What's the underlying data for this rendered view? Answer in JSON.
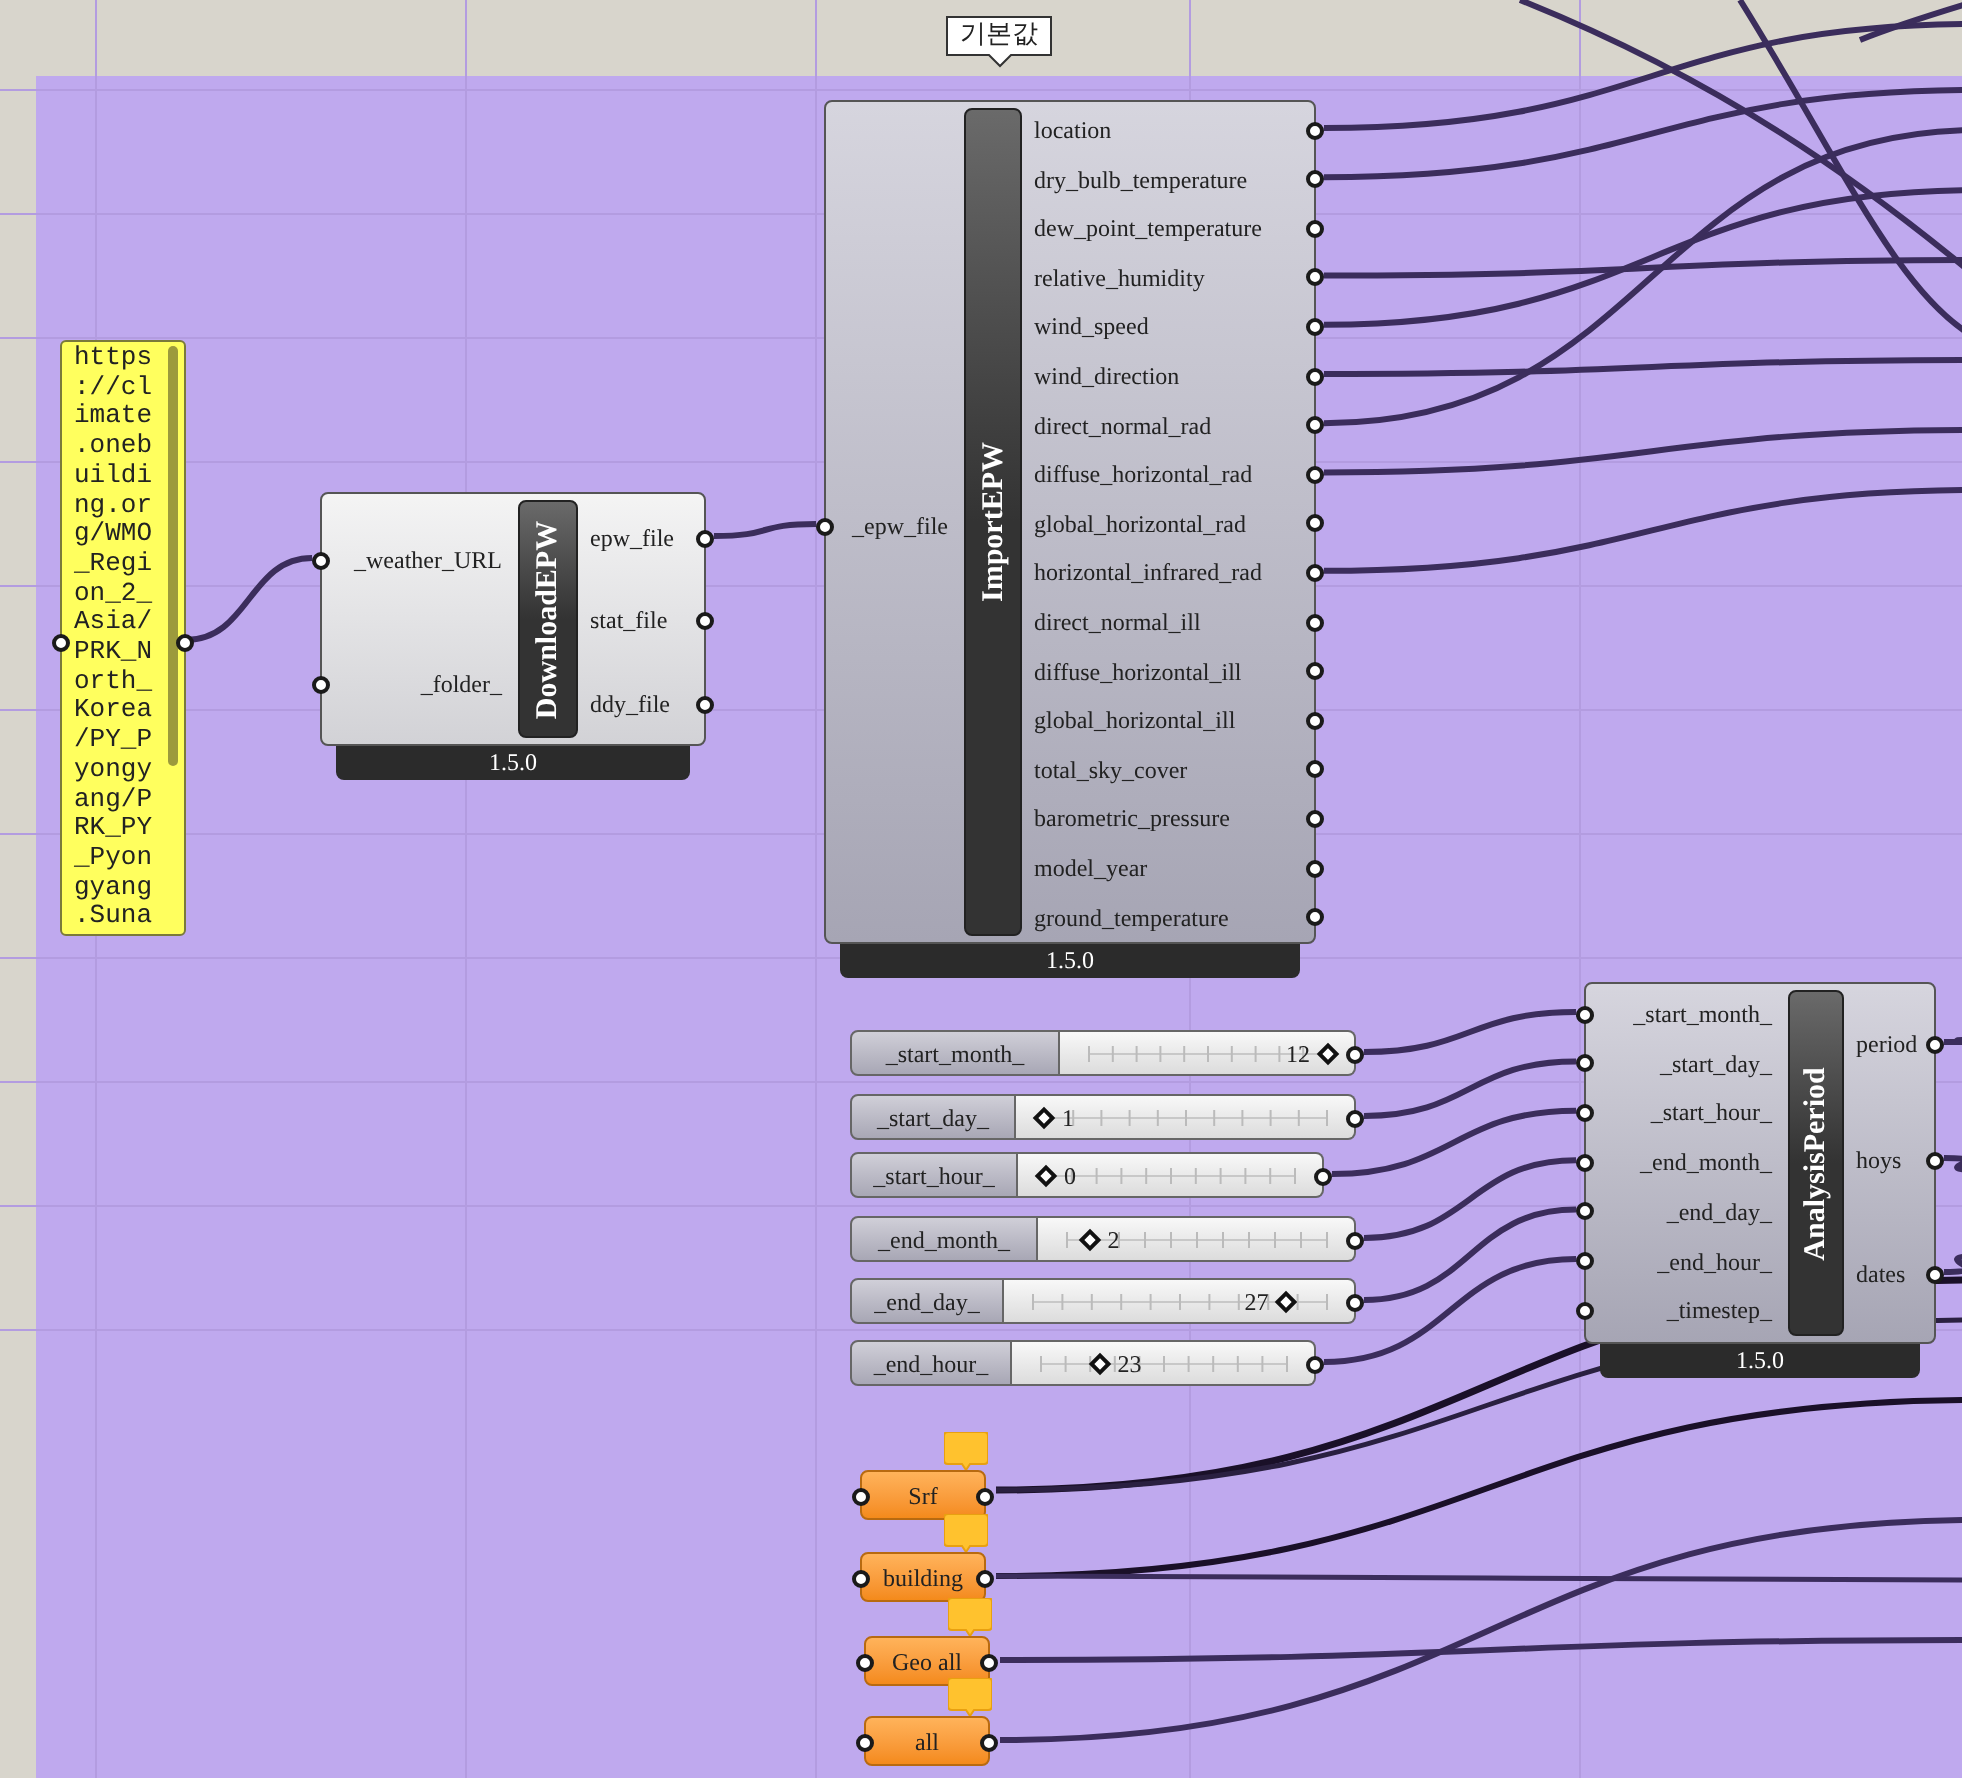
{
  "tooltip": "기본값",
  "panel": {
    "text": "https://climate.onebuilding.org/WMO_Region_2_Asia/PRK_North_Korea/PY_Pyongyang/PRK_PY_Pyongyang.Suna"
  },
  "components": [
    {
      "title": "DownloadEPW",
      "inputs": [
        "_weather_URL",
        "_folder_"
      ],
      "outputs": [
        "epw_file",
        "stat_file",
        "ddy_file"
      ],
      "version": "1.5.0"
    },
    {
      "title": "ImportEPW",
      "inputs": [
        "_epw_file"
      ],
      "outputs": [
        "location",
        "dry_bulb_temperature",
        "dew_point_temperature",
        "relative_humidity",
        "wind_speed",
        "wind_direction",
        "direct_normal_rad",
        "diffuse_horizontal_rad",
        "global_horizontal_rad",
        "horizontal_infrared_rad",
        "direct_normal_ill",
        "diffuse_horizontal_ill",
        "global_horizontal_ill",
        "total_sky_cover",
        "barometric_pressure",
        "model_year",
        "ground_temperature"
      ],
      "version": "1.5.0"
    },
    {
      "title": "AnalysisPeriod",
      "inputs": [
        "_start_month_",
        "_start_day_",
        "_start_hour_",
        "_end_month_",
        "_end_day_",
        "_end_hour_",
        "_timestep_"
      ],
      "outputs": [
        "period",
        "hoys",
        "dates"
      ],
      "version": "1.5.0"
    }
  ],
  "sliders": [
    {
      "name": "_start_month_",
      "value": "12",
      "level": 1
    },
    {
      "name": "_start_day_",
      "value": "1",
      "level": 0
    },
    {
      "name": "_start_hour_",
      "value": "0",
      "level": 0
    },
    {
      "name": "_end_month_",
      "value": "2",
      "level": 0.09
    },
    {
      "name": "_end_day_",
      "value": "27",
      "level": 0.86
    },
    {
      "name": "_end_hour_",
      "value": "23",
      "level": 0.24
    }
  ],
  "params": [
    {
      "label": "Srf"
    },
    {
      "label": "building"
    },
    {
      "label": "Geo all"
    },
    {
      "label": "all"
    }
  ]
}
